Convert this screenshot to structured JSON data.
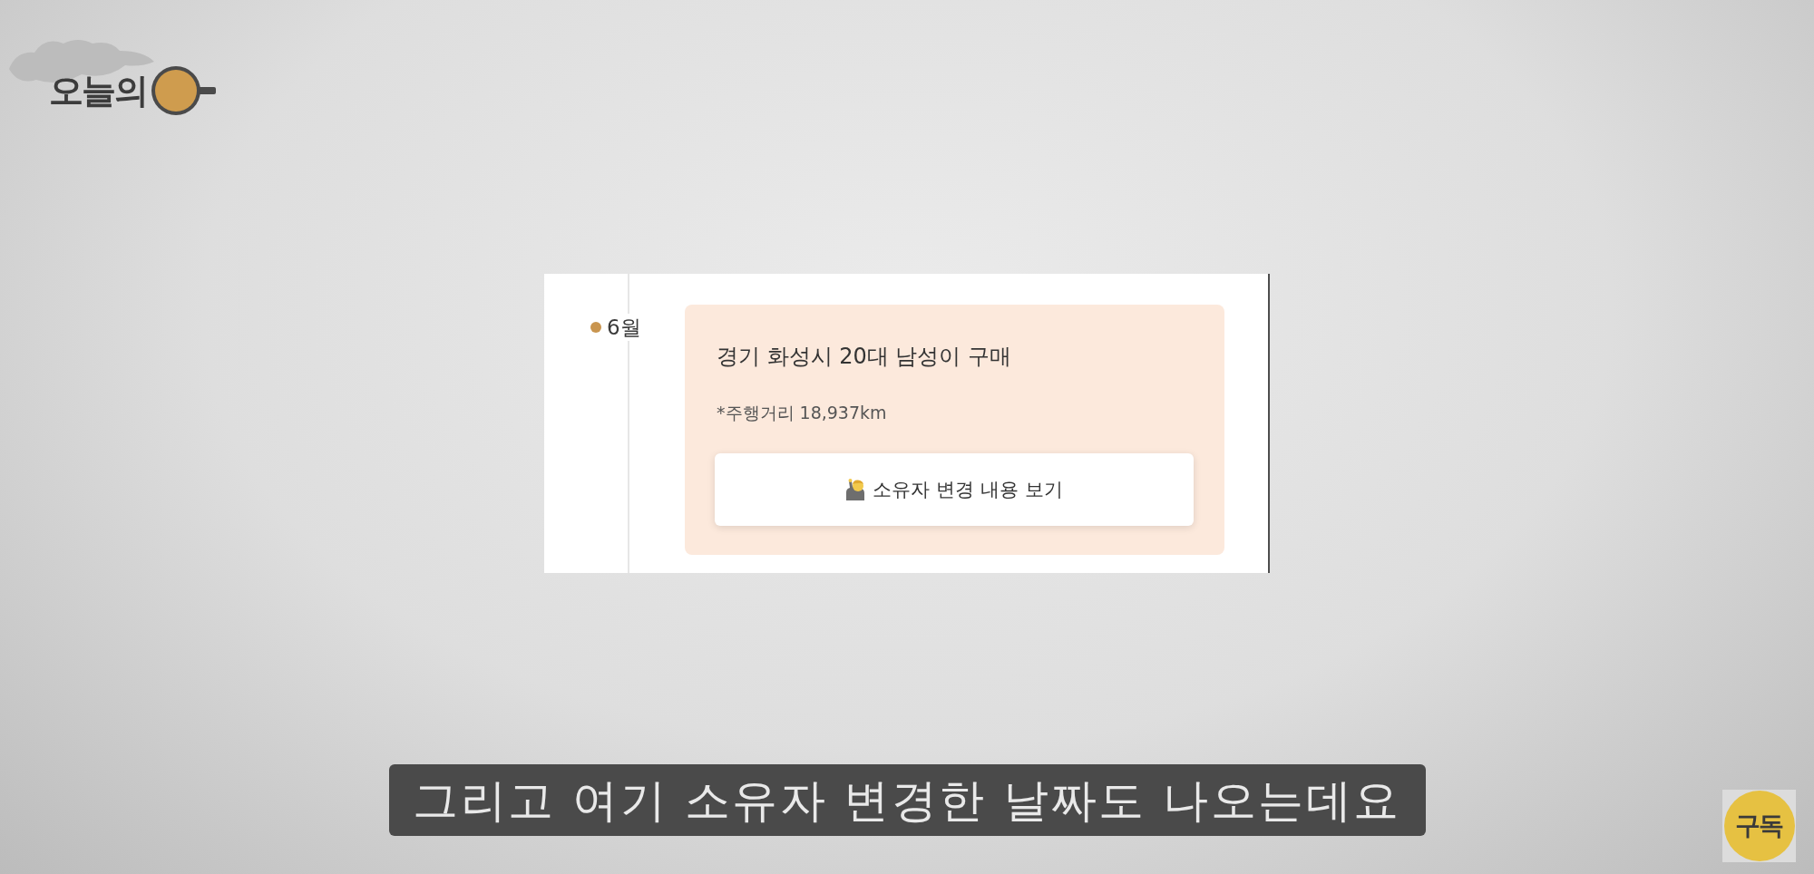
{
  "logo": {
    "title": "오늘의"
  },
  "timeline": {
    "entries": [
      {
        "month": "6월",
        "event": {
          "title": "경기 화성시 20대 남성이 구매",
          "note": "*주행거리 18,937km",
          "button": {
            "label": "소유자 변경 내용 보기"
          }
        }
      }
    ]
  },
  "caption": {
    "text": "그리고 여기 소유자 변경한 날짜도 나오는데요"
  },
  "subscribe_button": {
    "label": "구독"
  }
}
